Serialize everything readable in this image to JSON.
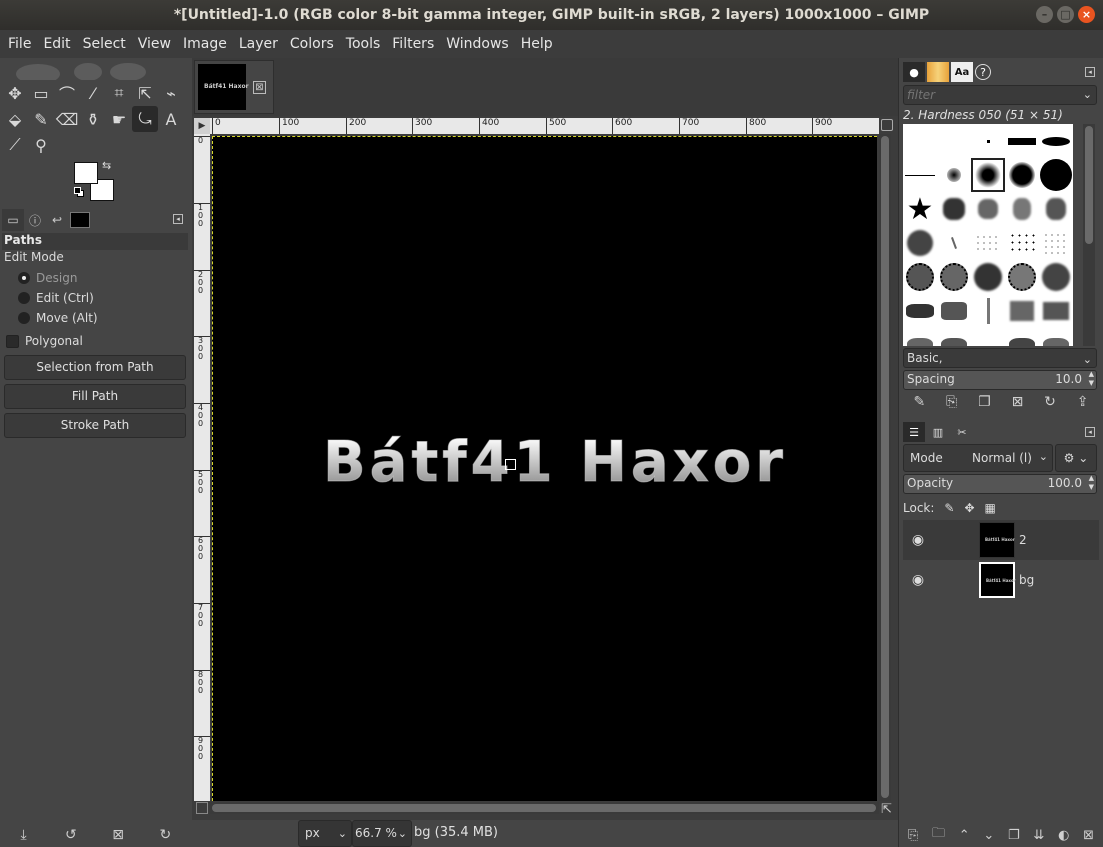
{
  "window": {
    "title": "*[Untitled]-1.0 (RGB color 8-bit gamma integer, GIMP built-in sRGB, 2 layers) 1000x1000 – GIMP",
    "min_glyph": "–",
    "max_glyph": "□",
    "close_glyph": "×"
  },
  "menu": [
    "File",
    "Edit",
    "Select",
    "View",
    "Image",
    "Layer",
    "Colors",
    "Tools",
    "Filters",
    "Windows",
    "Help"
  ],
  "toolbox": {
    "row1": [
      "move-tool",
      "rect-select-tool",
      "free-select-tool",
      "fuzzy-select-tool",
      "crop-tool",
      "unified-transform-tool",
      "warp-transform-tool"
    ],
    "row2": [
      "bucket-fill-tool",
      "paintbrush-tool",
      "eraser-tool",
      "clone-tool",
      "smudge-tool",
      "paths-tool",
      "text-tool"
    ],
    "row3": [
      "color-picker-tool",
      "zoom-tool"
    ],
    "glyphs1": [
      "✥",
      "▭",
      "⌒",
      "⁄",
      "⌗",
      "⇱",
      "⌁"
    ],
    "glyphs2": [
      "⬙",
      "✎",
      "⌫",
      "⚱",
      "☛",
      "⤿",
      "A"
    ],
    "glyphs3": [
      "⟋",
      "⚲"
    ],
    "fg_color": "#ffffff",
    "bg_color": "#ffffff"
  },
  "tool_options": {
    "title": "Paths",
    "edit_mode_label": "Edit Mode",
    "modes": [
      "Design",
      "Edit (Ctrl)",
      "Move (Alt)"
    ],
    "selected_mode": "Design",
    "polygonal_label": "Polygonal",
    "polygonal_checked": false,
    "buttons": {
      "selection_from_path": "Selection from Path",
      "fill_path": "Fill Path",
      "stroke_path": "Stroke Path"
    }
  },
  "image_tab": {
    "thumb_text": "Bátf41 Haxor",
    "close_glyph": "⊠"
  },
  "rulers": {
    "h_labels": [
      "0",
      "100",
      "200",
      "300",
      "400",
      "500",
      "600",
      "700",
      "800",
      "900"
    ],
    "v_labels": [
      "0",
      "1 0 0",
      "2 0 0",
      "3 0 0",
      "4 0 0",
      "5 0 0",
      "6 0 0",
      "7 0 0",
      "8 0 0",
      "9 0 0"
    ]
  },
  "canvas": {
    "text": "Bátf41 Haxor",
    "background": "#000000"
  },
  "status": {
    "unit": "px",
    "zoom": "66.7 %",
    "info": "bg (35.4 MB)"
  },
  "brushes": {
    "filter_placeholder": "filter",
    "current_brush": "2. Hardness 050 (51 × 51)",
    "preset": "Basic,",
    "spacing_label": "Spacing",
    "spacing_value": "10.0"
  },
  "layers": {
    "mode_label": "Mode",
    "mode_value": "Normal (l)",
    "opacity_label": "Opacity",
    "opacity_value": "100.0",
    "lock_label": "Lock:",
    "items": [
      {
        "name": "2",
        "thumb_text": "Bátf41 Haxor",
        "visible": true,
        "selected": true
      },
      {
        "name": "bg",
        "thumb_text": "Bátf41 Haxor",
        "visible": true,
        "selected": false
      }
    ]
  }
}
